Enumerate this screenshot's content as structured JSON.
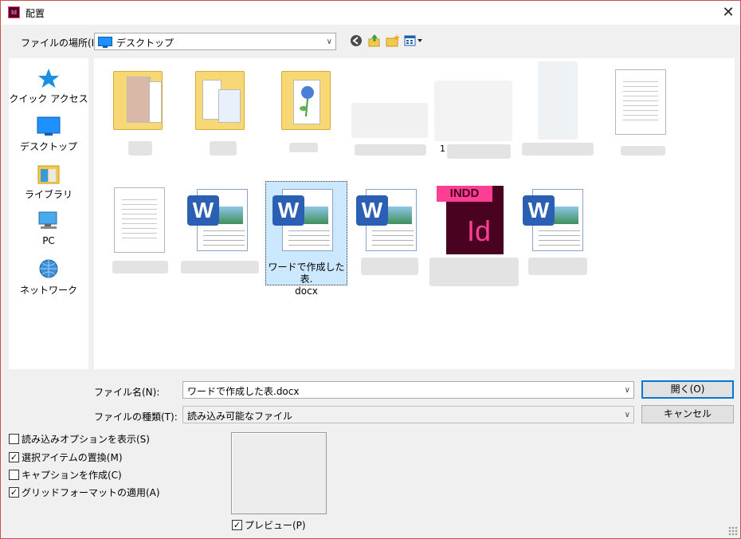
{
  "window": {
    "title": "配置",
    "app_icon_text": "Id",
    "close_glyph": "✕"
  },
  "lookin": {
    "label": "ファイルの場所(I):",
    "value": "デスクトップ"
  },
  "toolbar": {
    "back_icon": "back-arrow-icon",
    "up_icon": "up-folder-icon",
    "new_folder_icon": "new-folder-icon",
    "view_menu_icon": "view-menu-icon"
  },
  "sidebar": {
    "items": [
      {
        "label": "クイック アクセス",
        "icon": "star-icon"
      },
      {
        "label": "デスクトップ",
        "icon": "desktop-icon"
      },
      {
        "label": "ライブラリ",
        "icon": "library-icon"
      },
      {
        "label": "PC",
        "icon": "pc-icon"
      },
      {
        "label": "ネットワーク",
        "icon": "network-icon"
      }
    ]
  },
  "files": {
    "partial_label": "1",
    "selected_caption_line1": "ワードで作成した表.",
    "selected_caption_line2": "docx",
    "indd_text": "INDD",
    "indd_logo": "Id",
    "word_badge": "W"
  },
  "form": {
    "filename_label": "ファイル名(N):",
    "filename_value": "ワードで作成した表.docx",
    "filetype_label": "ファイルの種類(T):",
    "filetype_value": "読み込み可能なファイル",
    "open_button": "開く(O)",
    "cancel_button": "キャンセル"
  },
  "options": [
    {
      "label": "読み込みオプションを表示(S)",
      "checked": false
    },
    {
      "label": "選択アイテムの置換(M)",
      "checked": true
    },
    {
      "label": "キャプションを作成(C)",
      "checked": false
    },
    {
      "label": "グリッドフォーマットの適用(A)",
      "checked": true
    }
  ],
  "preview": {
    "label": "プレビュー(P)",
    "checked": true
  },
  "colors": {
    "accent": "#0078d7",
    "selection": "#cce8ff",
    "word_blue": "#2b5fb4",
    "indd_pink": "#ff3f94"
  }
}
